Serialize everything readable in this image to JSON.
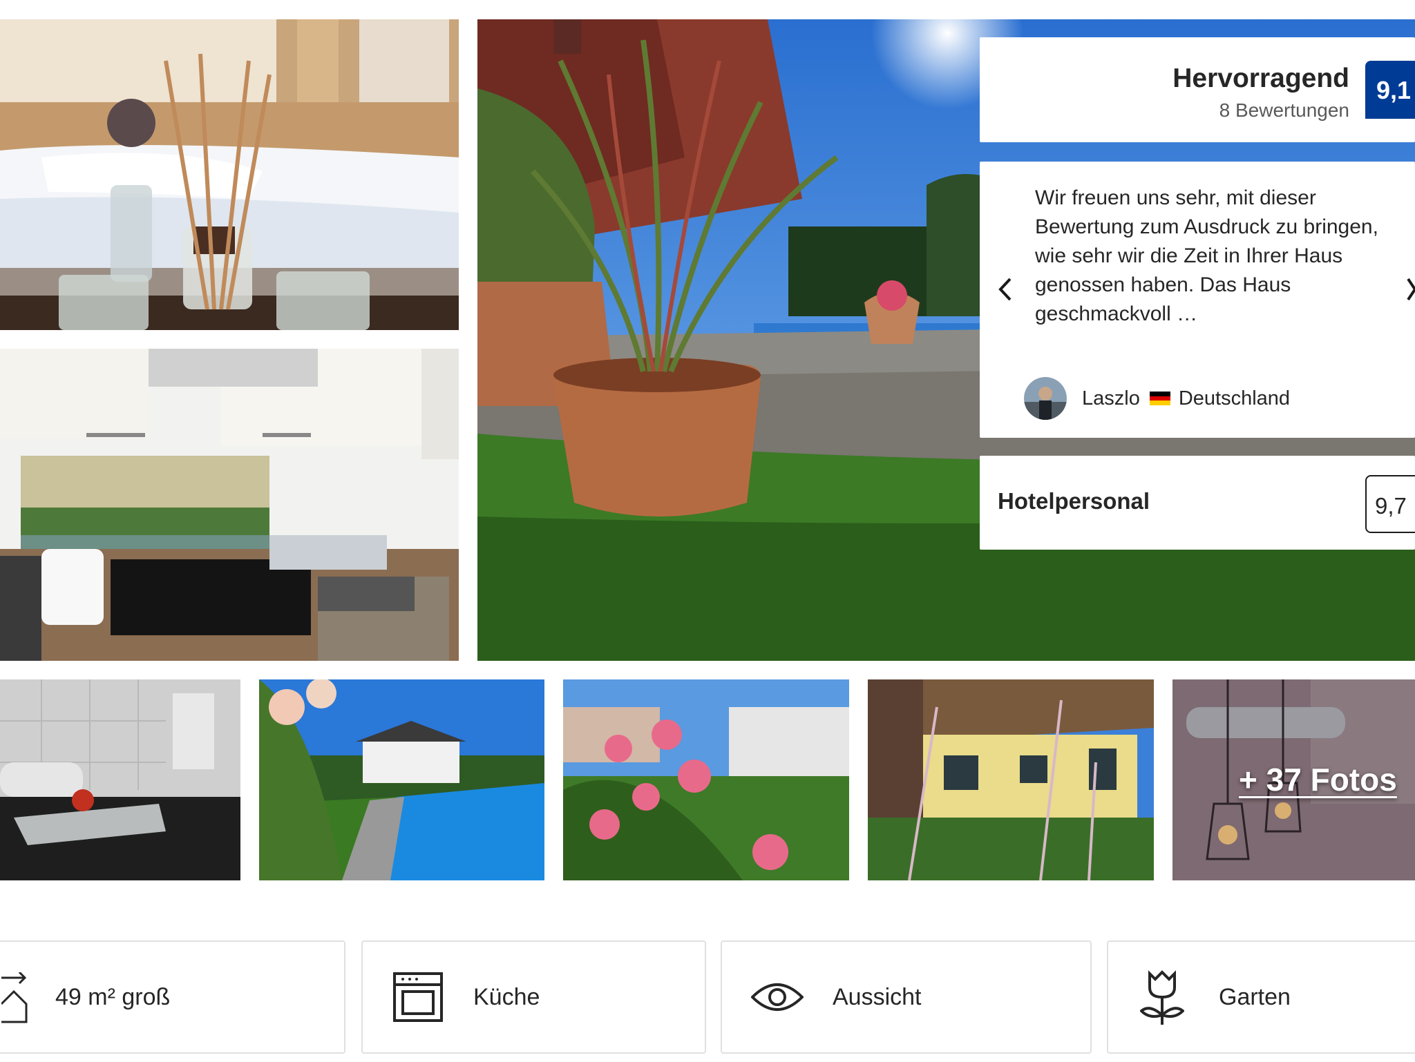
{
  "photos": {
    "main": [
      {
        "name": "bedroom"
      },
      {
        "name": "kitchen"
      },
      {
        "name": "garden-patio"
      }
    ],
    "thumbnails": [
      {
        "name": "bathroom"
      },
      {
        "name": "pool"
      },
      {
        "name": "flowers"
      },
      {
        "name": "house"
      },
      {
        "name": "lamps"
      }
    ],
    "more_label": "+ 37 Fotos"
  },
  "rating": {
    "word": "Hervorragend",
    "count": "8 Bewertungen",
    "score": "9,1",
    "badge_color": "#003b95"
  },
  "review": {
    "text": "Wir freuen uns sehr, mit dieser Bewertung zum Ausdruck zu bringen, wie sehr wir die Zeit in Ihrer Haus genossen haben. Das Haus geschmackvoll …",
    "reviewer": "Laszlo",
    "country": "Deutschland",
    "prev_icon": "chevron-left-icon",
    "next_icon": "chevron-right-icon"
  },
  "category": {
    "label": "Hotelpersonal",
    "score": "9,7"
  },
  "facilities": [
    {
      "label": "49 m² groß",
      "icon": "area-icon"
    },
    {
      "label": "Küche",
      "icon": "oven-icon"
    },
    {
      "label": "Aussicht",
      "icon": "eye-icon"
    },
    {
      "label": "Garten",
      "icon": "flower-icon"
    }
  ]
}
